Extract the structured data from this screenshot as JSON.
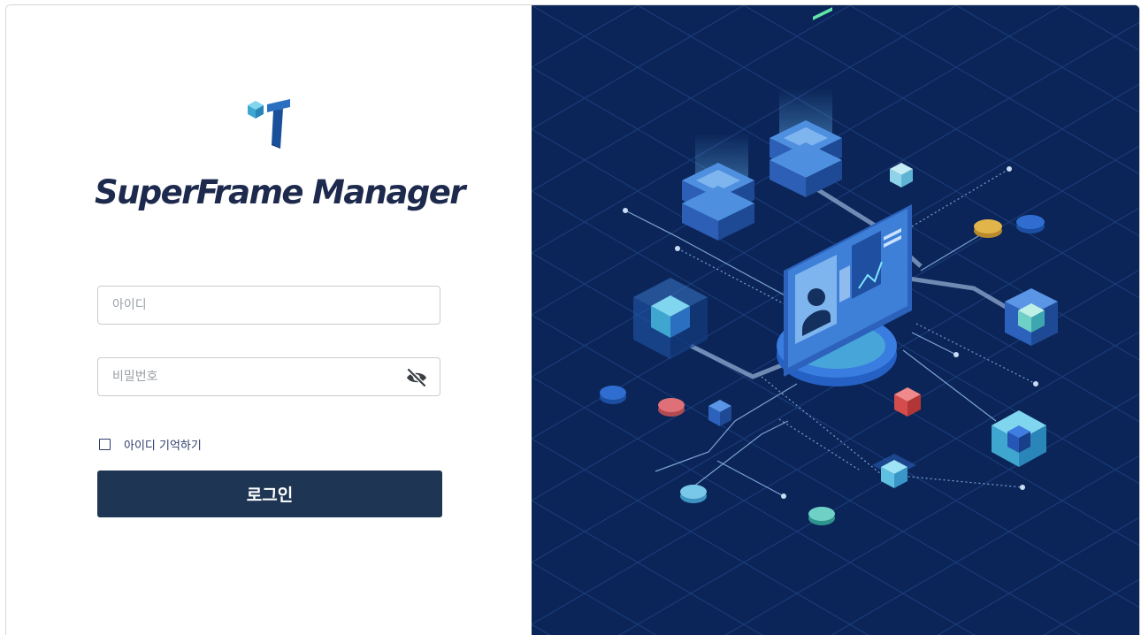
{
  "brand": {
    "name": "SuperFrame Manager",
    "colors": {
      "navy": "#1e2a4d",
      "cube_light": "#4fb6d6",
      "cube_dark": "#1f5aa8"
    }
  },
  "login_form": {
    "id_placeholder": "아이디",
    "id_value": "",
    "password_placeholder": "비밀번호",
    "password_value": "",
    "password_toggle_icon": "eye-slash-icon",
    "remember_label": "아이디 기억하기",
    "remember_checked": false,
    "submit_label": "로그인",
    "button_color": "#1e3553"
  },
  "illustration": {
    "subject": "isometric-network-server-illustration",
    "background_color": "#0b2558"
  }
}
